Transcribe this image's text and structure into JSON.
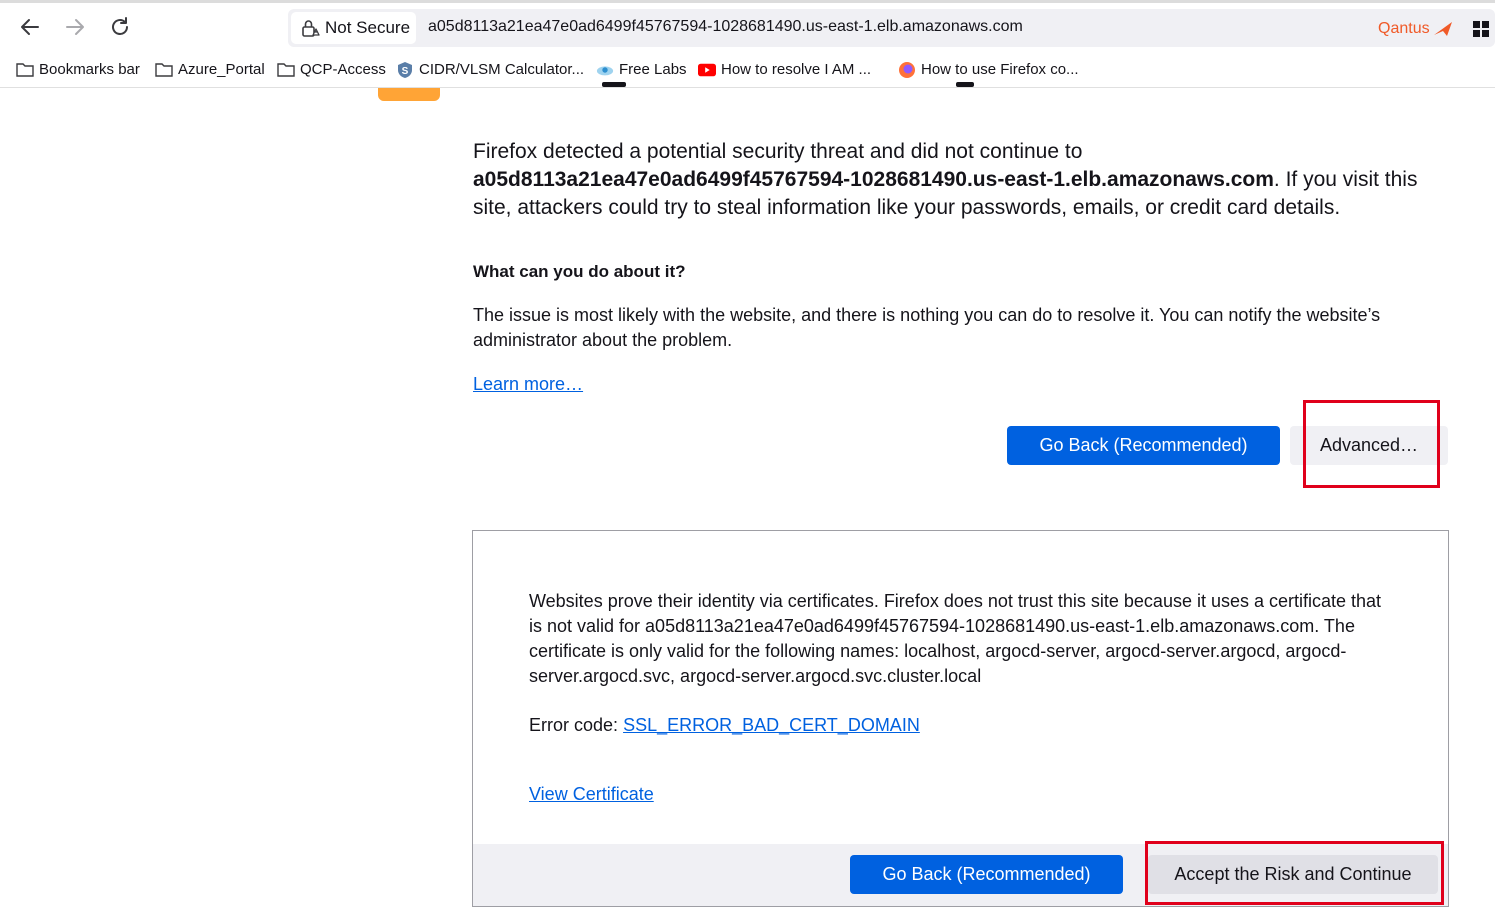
{
  "browser": {
    "security_label": "Not Secure",
    "url": "a05d8113a21ea47e0ad6499f45767594-1028681490.us-east-1.elb.amazonaws.com",
    "extension_label": "Qantus",
    "bookmarks": [
      {
        "label": "Bookmarks bar",
        "icon": "folder-icon"
      },
      {
        "label": "Azure_Portal",
        "icon": "folder-icon"
      },
      {
        "label": "QCP-Access",
        "icon": "folder-icon"
      },
      {
        "label": "CIDR/VLSM Calculator...",
        "icon": "shield-s-icon"
      },
      {
        "label": "Free Labs",
        "icon": "cloud-icon"
      },
      {
        "label": "How to resolve I AM ...",
        "icon": "youtube-icon"
      },
      {
        "label": "How to use Firefox co...",
        "icon": "firefox-icon"
      }
    ]
  },
  "page": {
    "intro_prefix": "Firefox detected a potential security threat and did not continue to",
    "intro_host": "a05d8113a21ea47e0ad6499f45767594-1028681490.us-east-1.elb.amazonaws.com",
    "intro_suffix": ". If you visit this site, attackers could try to steal information like your passwords, emails, or credit card details.",
    "what_heading": "What can you do about it?",
    "what_text": "The issue is most likely with the website, and there is nothing you can do to resolve it. You can notify the website’s administrator about the problem.",
    "learn_more": "Learn more…",
    "go_back_label": "Go Back (Recommended)",
    "advanced_label": "Advanced…"
  },
  "advanced": {
    "explanation": "Websites prove their identity via certificates. Firefox does not trust this site because it uses a certificate that is not valid for a05d8113a21ea47e0ad6499f45767594-1028681490.us-east-1.elb.amazonaws.com. The certificate is only valid for the following names: localhost, argocd-server, argocd-server.argocd, argocd-server.argocd.svc, argocd-server.argocd.svc.cluster.local",
    "error_code_label": "Error code:",
    "error_code": "SSL_ERROR_BAD_CERT_DOMAIN",
    "view_certificate": "View Certificate",
    "go_back_label": "Go Back (Recommended)",
    "accept_label": "Accept the Risk and Continue"
  },
  "colors": {
    "accent": "#0061e0",
    "warning": "#ffa436",
    "highlight": "#e0001b"
  }
}
